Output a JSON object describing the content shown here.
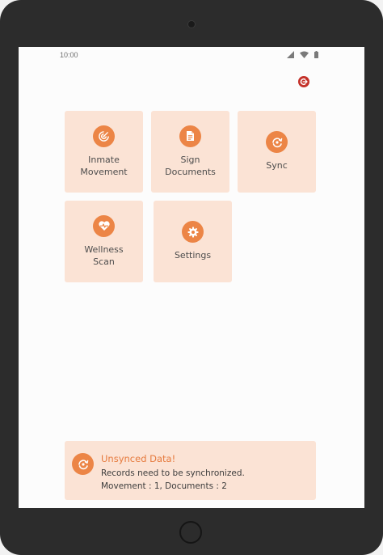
{
  "status_bar": {
    "time": "10:00"
  },
  "tiles": [
    {
      "label": "Inmate\nMovement",
      "icon": "radar-icon"
    },
    {
      "label": "Sign\nDocuments",
      "icon": "document-icon"
    },
    {
      "label": "Sync",
      "icon": "sync-icon"
    },
    {
      "label": "Wellness\nScan",
      "icon": "heartbeat-icon"
    },
    {
      "label": "Settings",
      "icon": "gear-icon"
    }
  ],
  "banner": {
    "title": "Unsynced Data!",
    "message": "Records need to be synchronized.",
    "counts": "Movement : 1, Documents : 2",
    "icon": "sync-icon"
  },
  "colors": {
    "accent": "#ec8546",
    "tile_bg": "#fbe3d5",
    "logout": "#c43129",
    "device_frame": "#2c2c2c"
  }
}
